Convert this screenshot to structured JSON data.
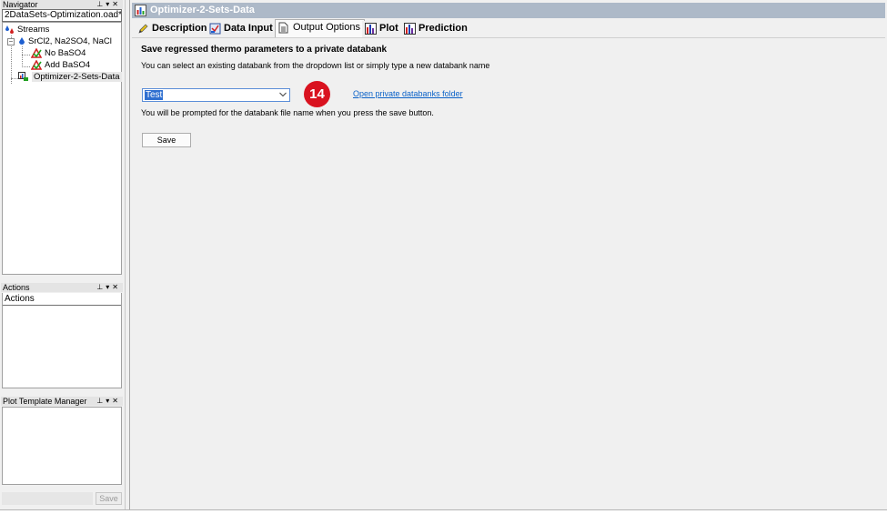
{
  "navigator": {
    "title": "Navigator",
    "file_name": "2DataSets-Optimization.oad*",
    "tree": {
      "root": "Streams",
      "stream": "SrCl2, Na2SO4, NaCl",
      "children": [
        "No BaSO4",
        "Add BaSO4"
      ],
      "optimizer": "Optimizer-2-Sets-Data"
    }
  },
  "actions": {
    "title": "Actions",
    "subheader": "Actions"
  },
  "plot_template_manager": {
    "title": "Plot Template Manager"
  },
  "left_save_label": "Save",
  "window": {
    "title": "Optimizer-2-Sets-Data"
  },
  "tabs": [
    {
      "label": "Description",
      "icon": "pencil-icon"
    },
    {
      "label": "Data Input",
      "icon": "data-input-icon"
    },
    {
      "label": "Output Options",
      "icon": "document-icon"
    },
    {
      "label": "Plot",
      "icon": "bar-chart-icon"
    },
    {
      "label": "Prediction",
      "icon": "bar-chart-icon"
    }
  ],
  "output_options": {
    "heading": "Save regressed thermo parameters to a private databank",
    "subtext": "You can select an existing databank from the dropdown list or simply type a new databank name",
    "databank_value": "Test",
    "step_badge": "14",
    "folder_link": "Open private databanks folder",
    "prompt_text": "You will be prompted for the databank file name when you press the save button.",
    "save_label": "Save"
  },
  "colors": {
    "title_bar": "#adb9c8",
    "badge": "#d9121f",
    "link": "#0b62c8",
    "selection": "#2f6fd0"
  }
}
